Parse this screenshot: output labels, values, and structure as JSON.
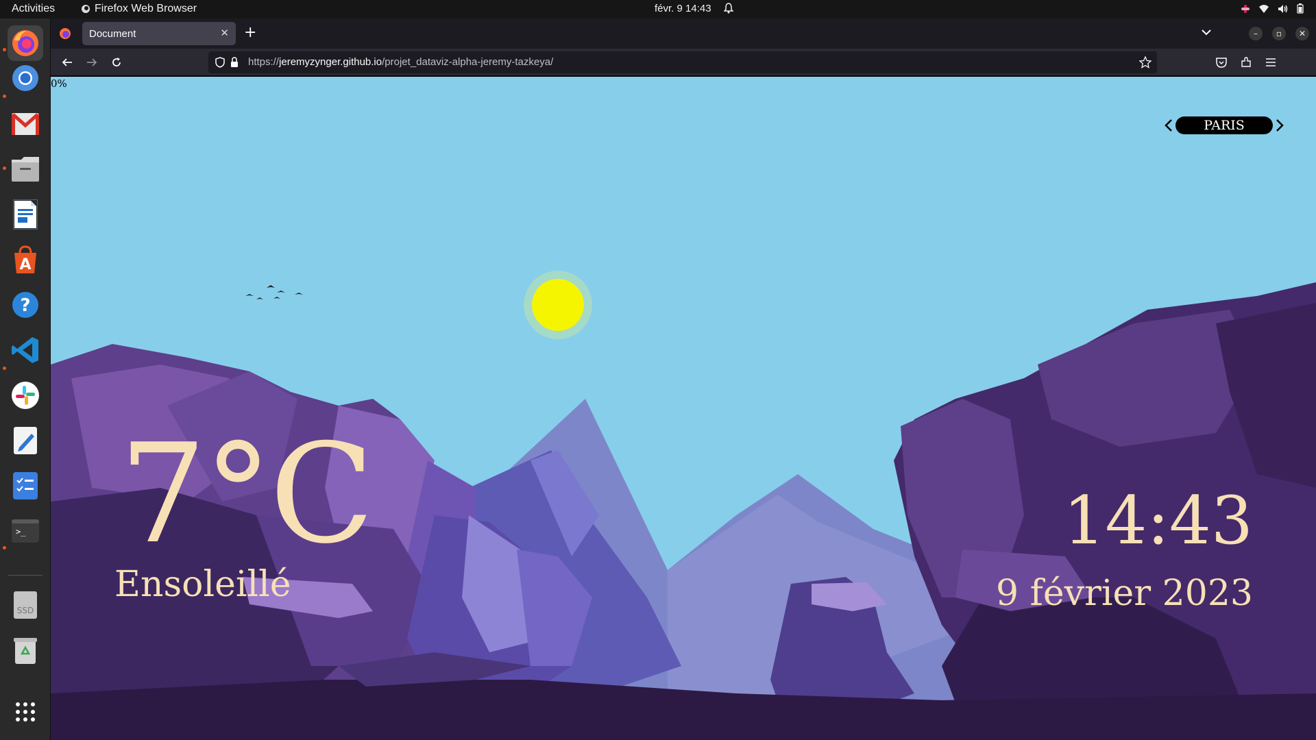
{
  "topbar": {
    "activities": "Activities",
    "app_name": "Firefox Web Browser",
    "clock": "févr. 9  14:43"
  },
  "dock": {
    "apps": [
      "firefox-icon",
      "chromium-icon",
      "gmail-icon",
      "files-icon",
      "writer-icon",
      "app-center-icon",
      "help-icon",
      "vscode-icon",
      "slack-icon",
      "text-editor-icon",
      "tasks-icon",
      "terminal-icon",
      "ssd-icon",
      "trash-icon",
      "app-grid-icon"
    ],
    "ssd_label": "SSD"
  },
  "browser": {
    "tab_title": "Document",
    "url_prefix": "https://",
    "url_host": "jeremyzynger.github.io",
    "url_path": "/projet_dataviz-alpha-jeremy-tazkeya/"
  },
  "page": {
    "progress": "0%",
    "city": "PARIS",
    "temperature": "7°C",
    "condition": "Ensoleillé",
    "time": "14:43",
    "date": "9 février 2023"
  },
  "colors": {
    "sky": "#87ceea",
    "sun": "#f5f500",
    "text_cream": "#f7e0b5"
  }
}
